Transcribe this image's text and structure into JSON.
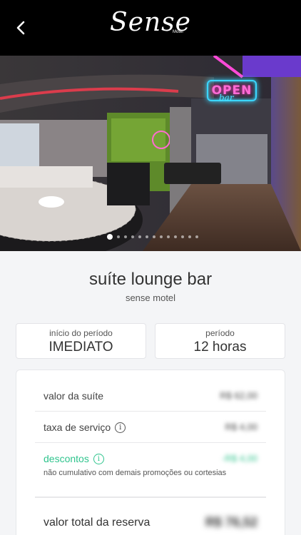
{
  "header": {
    "back_icon": "chevron-left-icon",
    "logo_text": "Sense",
    "logo_subtext": "Motel"
  },
  "hero": {
    "sign_main": "OPEN",
    "sign_sub": "bar",
    "slide_count": 13,
    "active_slide": 1
  },
  "suite": {
    "title": "suíte lounge bar",
    "motel_name": "sense motel"
  },
  "period": {
    "start_label": "início do período",
    "start_value": "IMEDIATO",
    "duration_label": "período",
    "duration_value": "12 horas"
  },
  "pricing": {
    "suite_label": "valor da suíte",
    "suite_value": "R$ 62,00",
    "service_label": "taxa de serviço",
    "service_value": "R$ 4,00",
    "discount_label": "descontos",
    "discount_value": "-R$ 4,00",
    "discount_note": "não cumulativo com demais promoções ou cortesias",
    "total_label": "valor total da reserva",
    "total_value": "R$ 76,52"
  },
  "colors": {
    "header_bg": "#000000",
    "accent_green": "#2fc48d",
    "page_bg": "#f4f5f7"
  }
}
